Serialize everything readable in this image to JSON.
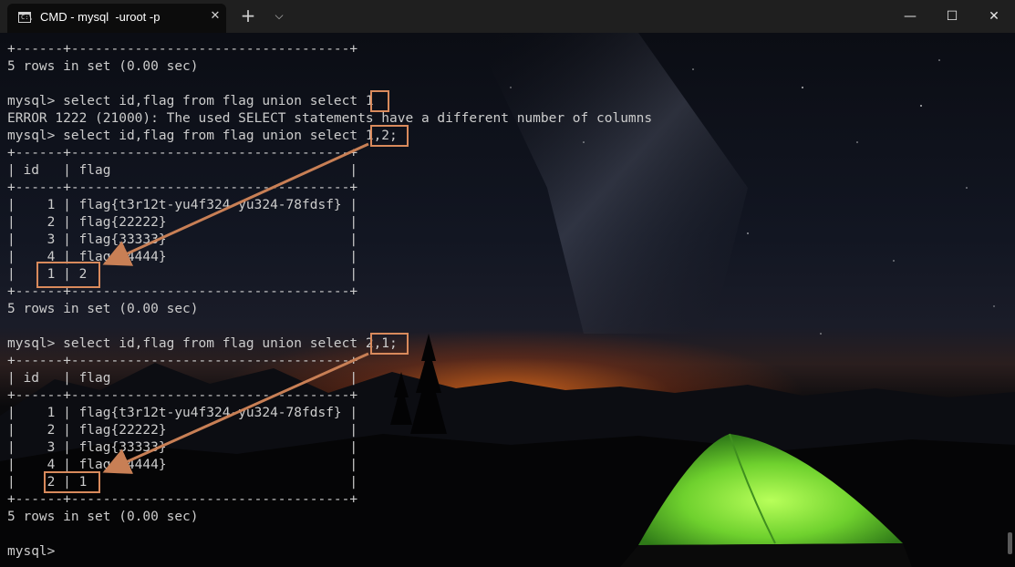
{
  "window": {
    "tab_title": "CMD - mysql  -uroot -p",
    "tab_icon": "cmd-console-icon",
    "tab_icon_glyph": "C:\\",
    "close_tab_glyph": "✕",
    "new_tab_glyph": "+",
    "dropdown_glyph": "⌵",
    "minimize_glyph": "—",
    "maximize_glyph": "☐",
    "close_glyph": "✕"
  },
  "terminal": {
    "lines": [
      "+------+-----------------------------------+",
      "5 rows in set (0.00 sec)",
      "",
      "mysql> select id,flag from flag union select 1",
      "ERROR 1222 (21000): The used SELECT statements have a different number of columns",
      "mysql> select id,flag from flag union select 1,2;",
      "+------+-----------------------------------+",
      "| id   | flag                              |",
      "+------+-----------------------------------+",
      "|    1 | flag{t3r12t-yu4f324-yu324-78fdsf} |",
      "|    2 | flag{22222}                       |",
      "|    3 | flag{33333}                       |",
      "|    4 | flag{44444}                       |",
      "|    1 | 2                                 |",
      "+------+-----------------------------------+",
      "5 rows in set (0.00 sec)",
      "",
      "mysql> select id,flag from flag union select 2,1;",
      "+------+-----------------------------------+",
      "| id   | flag                              |",
      "+------+-----------------------------------+",
      "|    1 | flag{t3r12t-yu4f324-yu324-78fdsf} |",
      "|    2 | flag{22222}                       |",
      "|    3 | flag{33333}                       |",
      "|    4 | flag{44444}                       |",
      "|    2 | 1                                 |",
      "+------+-----------------------------------+",
      "5 rows in set (0.00 sec)",
      "",
      "mysql>"
    ]
  },
  "annotations": {
    "box_color": "#d98a5c",
    "arrow_color": "#c87f55"
  },
  "background": {
    "theme": "night-sky-camping-tent",
    "tent_color": "#7fe33a",
    "glow_color": "#e8702a"
  }
}
